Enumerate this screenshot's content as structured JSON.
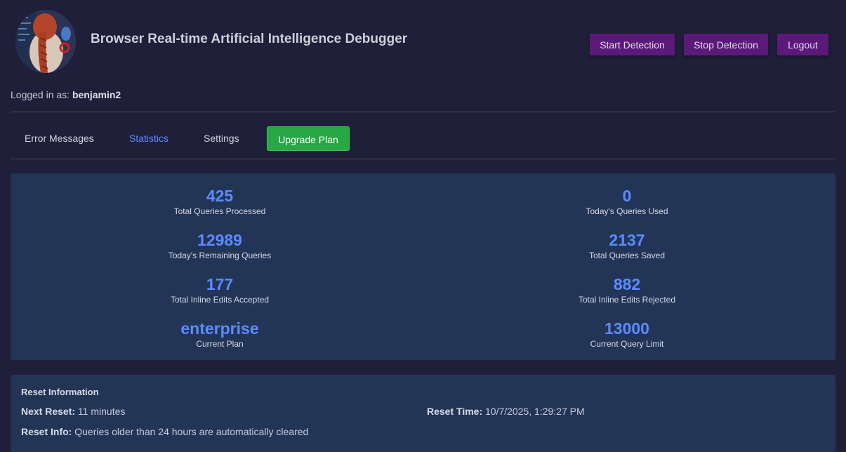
{
  "header": {
    "title": "Browser Real-time Artificial Intelligence Debugger",
    "avatar_icon": "avatar-portrait",
    "buttons": {
      "start": "Start Detection",
      "stop": "Stop Detection",
      "logout": "Logout"
    }
  },
  "user": {
    "prefix": "Logged in as:",
    "username": "benjamin2"
  },
  "tabs": {
    "errors": "Error Messages",
    "statistics": "Statistics",
    "settings": "Settings",
    "upgrade": "Upgrade Plan",
    "active": "statistics"
  },
  "stats": {
    "total_queries_processed": {
      "value": "425",
      "label": "Total Queries Processed"
    },
    "todays_queries_used": {
      "value": "0",
      "label": "Today's Queries Used"
    },
    "todays_remaining": {
      "value": "12989",
      "label": "Today's Remaining Queries"
    },
    "total_queries_saved": {
      "value": "2137",
      "label": "Total Queries Saved"
    },
    "inline_accepted": {
      "value": "177",
      "label": "Total Inline Edits Accepted"
    },
    "inline_rejected": {
      "value": "882",
      "label": "Total Inline Edits Rejected"
    },
    "current_plan": {
      "value": "enterprise",
      "label": "Current Plan"
    },
    "query_limit": {
      "value": "13000",
      "label": "Current Query Limit"
    }
  },
  "reset": {
    "heading": "Reset Information",
    "next_label": "Next Reset:",
    "next_value": "11 minutes",
    "time_label": "Reset Time:",
    "time_value": "10/7/2025, 1:29:27 PM",
    "info_label": "Reset Info:",
    "info_value": "Queries older than 24 hours are automatically cleared"
  },
  "colors": {
    "background": "#1f1f3a",
    "panel": "#233556",
    "accent_purple": "#5b1a7a",
    "stat_blue": "#5b8bff",
    "upgrade_green": "#28a745"
  }
}
